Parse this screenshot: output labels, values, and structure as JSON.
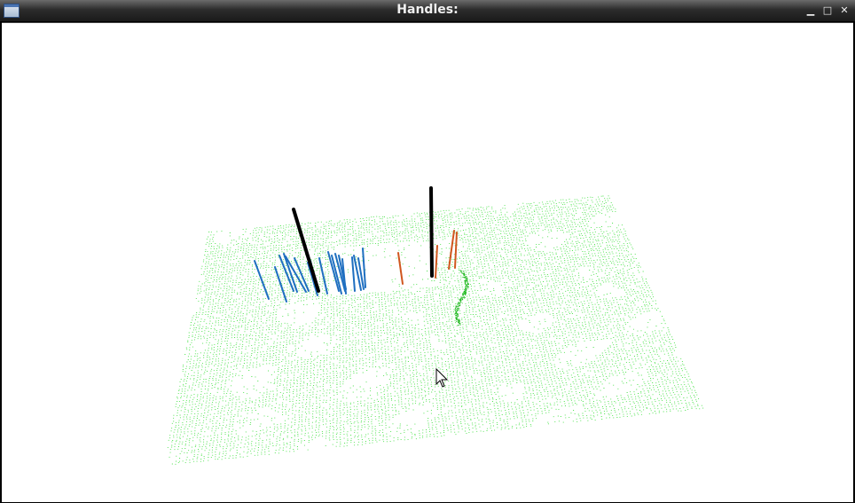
{
  "window": {
    "title": "Handles:",
    "controls": {
      "minimize": "▁",
      "maximize": "□",
      "close": "✕"
    }
  },
  "scene": {
    "point_cloud_color": "#3ce03c",
    "handle_colors": {
      "blue": "#1f6fc0",
      "orange": "#d0561e",
      "black": "#000000"
    }
  },
  "cursor": {
    "icon": "arrow-cursor-icon"
  }
}
